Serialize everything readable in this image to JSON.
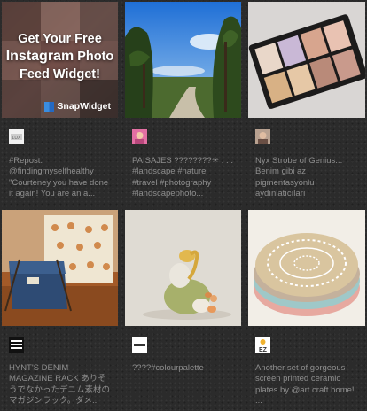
{
  "promo": {
    "line1": "Get Your Free",
    "line2_bold": "Instagram",
    "line2_rest": " Photo",
    "line3": "Feed Widget!",
    "brand": "SnapWidget"
  },
  "posts": [
    {
      "caption": "#Repost:\n@findingmyselfhealthy\n\"Courteney you have done\nit again! You are an a..."
    },
    {
      "caption": "PAISAJES ????????☀ . . .\n#landscape #nature\n#travel #photography\n#landscapephoto..."
    },
    {
      "caption": "Nyx Strobe of Genius...\nBenim gibi az\npigmentasyonlu\naydınlatıcıları"
    },
    {
      "caption": "HYNT'S DENIM\nMAGAZINE RACK ありそ\nうでなかったデニム素材の\nマガジンラック。ダメ..."
    },
    {
      "caption": "????#colourpalette"
    },
    {
      "caption": "Another set of gorgeous\nscreen printed ceramic\nplates by @art.craft.home!\n..."
    }
  ],
  "avatars": [
    {
      "icon": "brand-logo-avatar-icon"
    },
    {
      "icon": "portrait-avatar-icon"
    },
    {
      "icon": "portrait-avatar-icon"
    },
    {
      "icon": "square-logo-avatar-icon"
    },
    {
      "icon": "wordmark-avatar-icon"
    },
    {
      "icon": "ez-logo-avatar-icon"
    }
  ]
}
